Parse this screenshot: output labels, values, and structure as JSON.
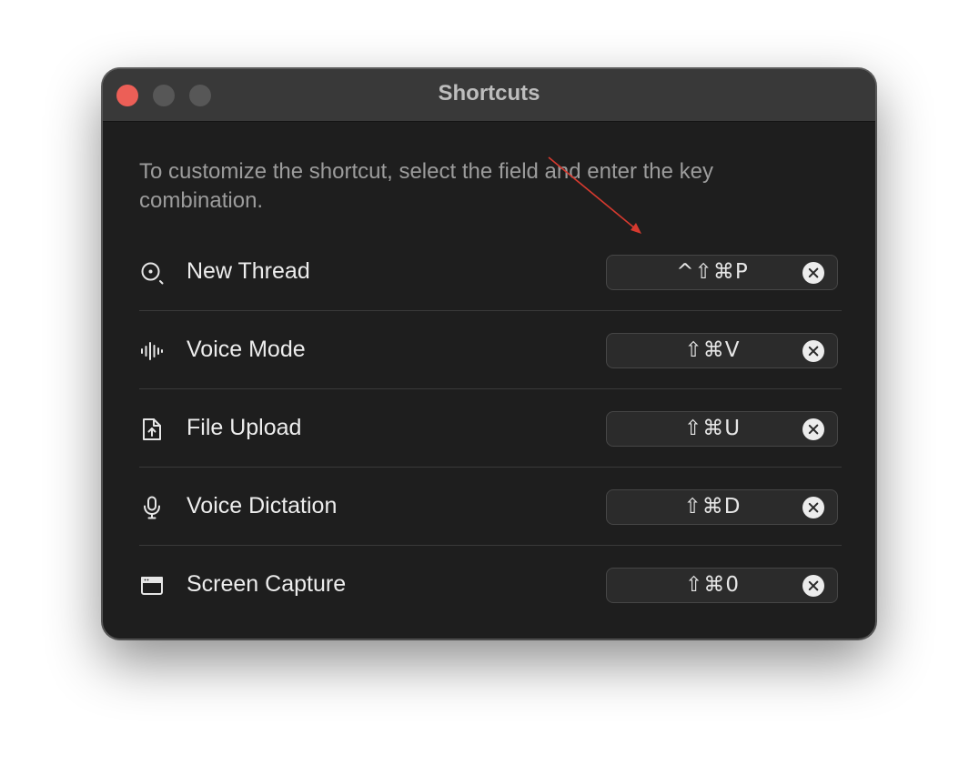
{
  "window": {
    "title": "Shortcuts"
  },
  "description": "To customize the shortcut, select the field and enter the key combination.",
  "annotation": {
    "arrow_color": "#d63a2f"
  },
  "shortcuts": [
    {
      "label": "New Thread",
      "keys": "^⇧⌘P",
      "icon": "search-icon"
    },
    {
      "label": "Voice Mode",
      "keys": "⇧⌘V",
      "icon": "waveform-icon"
    },
    {
      "label": "File Upload",
      "keys": "⇧⌘U",
      "icon": "file-upload-icon"
    },
    {
      "label": "Voice Dictation",
      "keys": "⇧⌘D",
      "icon": "microphone-icon"
    },
    {
      "label": "Screen Capture",
      "keys": "⇧⌘0",
      "icon": "screen-capture-icon"
    }
  ]
}
